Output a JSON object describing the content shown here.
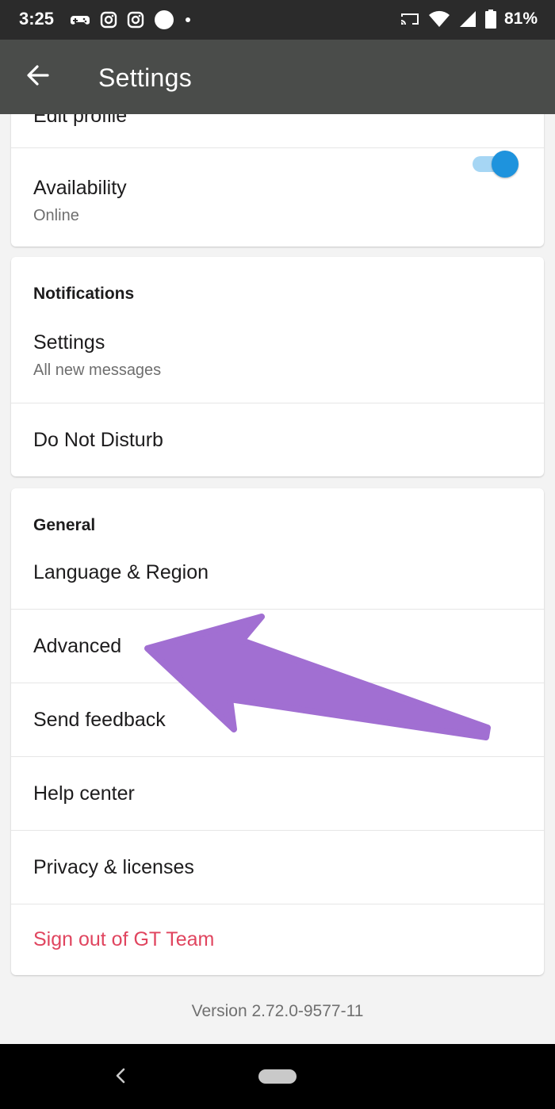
{
  "status_bar": {
    "time": "3:25",
    "battery": "81%",
    "icons": [
      "game-controller-icon",
      "instagram-icon",
      "instagram-icon",
      "dot-icon",
      "cast-icon",
      "wifi-icon",
      "signal-icon",
      "battery-icon"
    ]
  },
  "app_bar": {
    "title": "Settings",
    "back_icon": "arrow-left-icon"
  },
  "profile_card": {
    "edit_profile": "Edit profile",
    "availability_label": "Availability",
    "availability_value": "Online",
    "availability_toggle_on": true
  },
  "notifications_card": {
    "heading": "Notifications",
    "settings_label": "Settings",
    "settings_value": "All new messages",
    "dnd_label": "Do Not Disturb"
  },
  "general_card": {
    "heading": "General",
    "items": [
      {
        "label": "Language & Region"
      },
      {
        "label": "Advanced"
      },
      {
        "label": "Send feedback"
      },
      {
        "label": "Help center"
      },
      {
        "label": "Privacy & licenses"
      }
    ],
    "sign_out": "Sign out of GT Team"
  },
  "version": "Version 2.72.0-9577-11",
  "colors": {
    "accent_blue": "#1e93dd",
    "danger_red": "#e0455f",
    "annotation_purple": "#a16fd2",
    "app_bar": "#4a4c4a"
  }
}
